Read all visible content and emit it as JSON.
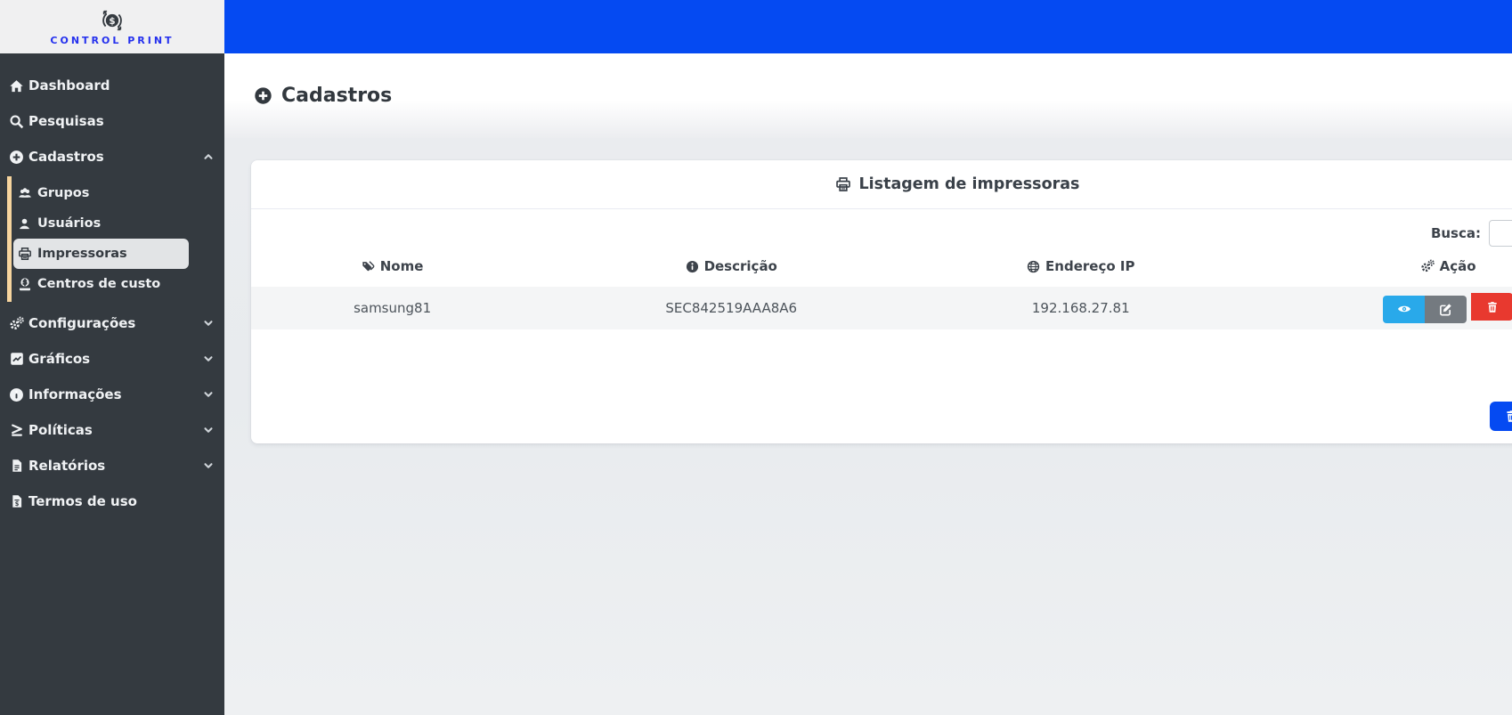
{
  "brand": {
    "name": "CONTROL PRINT"
  },
  "sidebar": {
    "items": [
      {
        "label": "Dashboard",
        "icon": "home-icon"
      },
      {
        "label": "Pesquisas",
        "icon": "search-icon"
      },
      {
        "label": "Cadastros",
        "icon": "plus-circle-icon",
        "expanded": true,
        "children": [
          {
            "label": "Grupos",
            "icon": "users-icon"
          },
          {
            "label": "Usuários",
            "icon": "user-icon"
          },
          {
            "label": "Impressoras",
            "icon": "printer-icon",
            "active": true
          },
          {
            "label": "Centros de custo",
            "icon": "donate-icon"
          }
        ]
      },
      {
        "label": "Configurações",
        "icon": "gears-icon",
        "collapsed": true
      },
      {
        "label": "Gráficos",
        "icon": "chart-icon",
        "collapsed": true
      },
      {
        "label": "Informações",
        "icon": "info-circle-icon",
        "collapsed": true
      },
      {
        "label": "Políticas",
        "icon": "greater-equal-icon",
        "collapsed": true
      },
      {
        "label": "Relatórios",
        "icon": "file-icon",
        "collapsed": true
      },
      {
        "label": "Termos de uso",
        "icon": "file-dollar-icon"
      }
    ]
  },
  "page": {
    "title": "Cadastros"
  },
  "card": {
    "title": "Listagem de impressoras",
    "search": {
      "label": "Busca:",
      "value": ""
    },
    "table": {
      "columns": [
        {
          "label": "Nome",
          "icon": "tags-icon"
        },
        {
          "label": "Descrição",
          "icon": "info-circle-icon"
        },
        {
          "label": "Endereço IP",
          "icon": "globe-icon"
        },
        {
          "label": "Ação",
          "icon": "gears-icon"
        }
      ],
      "rows": [
        {
          "nome": "samsung81",
          "descricao": "SEC842519AAA8A6",
          "endereco_ip": "192.168.27.81"
        }
      ]
    },
    "row_actions": [
      {
        "name": "view",
        "icon": "eye-icon",
        "color": "#29a9ea"
      },
      {
        "name": "edit",
        "icon": "edit-icon",
        "color": "#747a80"
      },
      {
        "name": "delete",
        "icon": "trash-icon",
        "color": "#e8392f"
      }
    ],
    "footer_action": {
      "name": "delete",
      "icon": "trash-icon",
      "color": "#054af2"
    }
  },
  "colors": {
    "topbar": "#054af2",
    "sidebar_bg": "#343a40",
    "brand_text": "#2430ee",
    "submenu_accent": "#f6d49e",
    "active_item_bg": "#e2e4e6",
    "row_stripe": "#f4f5f6"
  }
}
